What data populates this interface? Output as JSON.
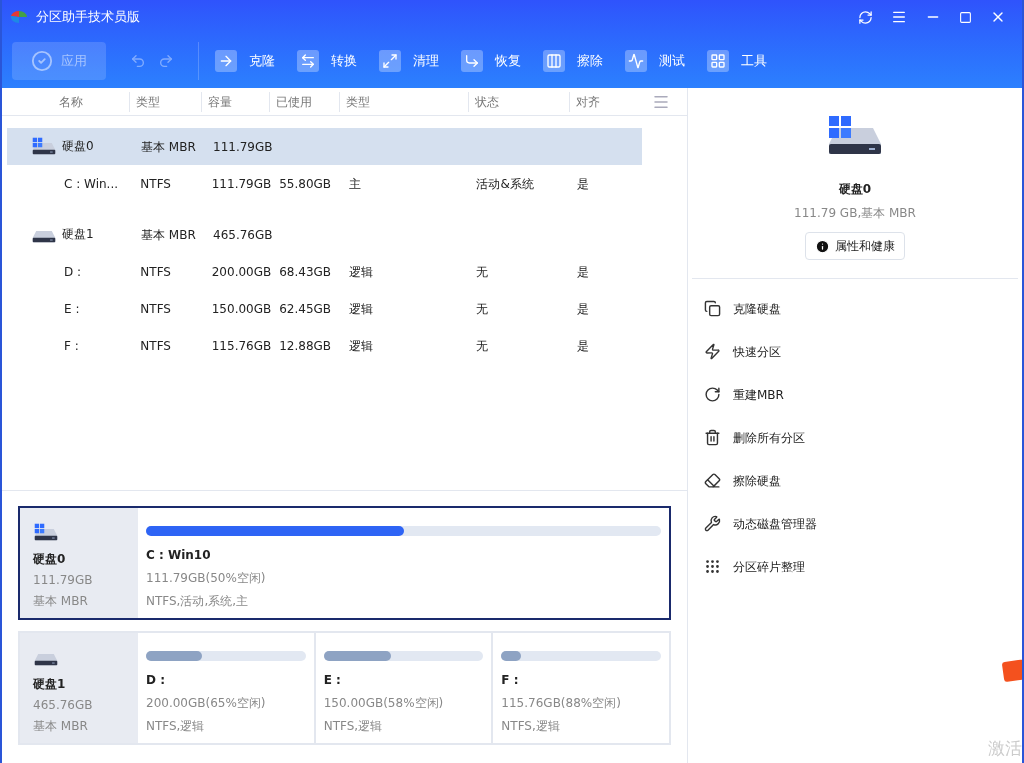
{
  "window": {
    "title": "分区助手技术员版"
  },
  "toolbar": {
    "apply": {
      "label": "应用",
      "disabled": true
    },
    "items": [
      {
        "kind": "clone",
        "label": "克隆"
      },
      {
        "kind": "convert",
        "label": "转换"
      },
      {
        "kind": "clean",
        "label": "清理"
      },
      {
        "kind": "recover",
        "label": "恢复"
      },
      {
        "kind": "wipe",
        "label": "擦除"
      },
      {
        "kind": "test",
        "label": "测试"
      },
      {
        "kind": "tools",
        "label": "工具"
      }
    ]
  },
  "table": {
    "columns": [
      "名称",
      "类型",
      "容量",
      "已使用",
      "类型",
      "状态",
      "对齐"
    ],
    "rows": [
      {
        "kind": "disk",
        "os": true,
        "selected": true,
        "cells": [
          "硬盘0",
          "基本 MBR",
          "111.79GB"
        ]
      },
      {
        "kind": "partition",
        "selected": false,
        "cells": [
          "C : Win...",
          "NTFS",
          "111.79GB",
          "55.80GB",
          "主",
          "活动&系统",
          "是"
        ]
      },
      {
        "kind": "disk",
        "os": false,
        "selected": false,
        "cells": [
          "硬盘1",
          "基本 MBR",
          "465.76GB"
        ]
      },
      {
        "kind": "partition",
        "selected": false,
        "cells": [
          "D :",
          "NTFS",
          "200.00GB",
          "68.43GB",
          "逻辑",
          "无",
          "是"
        ]
      },
      {
        "kind": "partition",
        "selected": false,
        "cells": [
          "E :",
          "NTFS",
          "150.00GB",
          "62.45GB",
          "逻辑",
          "无",
          "是"
        ]
      },
      {
        "kind": "partition",
        "selected": false,
        "cells": [
          "F :",
          "NTFS",
          "115.76GB",
          "12.88GB",
          "逻辑",
          "无",
          "是"
        ]
      }
    ]
  },
  "disk_map": [
    {
      "name": "硬盘0",
      "size": "111.79GB",
      "type": "基本 MBR",
      "os": true,
      "selected": true,
      "partitions": [
        {
          "name": "C : Win10",
          "detail": "111.79GB(50%空闲)",
          "attributes": "NTFS,活动,系统,主",
          "level": 0.5,
          "primary": true
        }
      ]
    },
    {
      "name": "硬盘1",
      "size": "465.76GB",
      "type": "基本 MBR",
      "os": false,
      "selected": false,
      "partitions": [
        {
          "name": "D :",
          "detail": "200.00GB(65%空闲)",
          "attributes": "NTFS,逻辑",
          "level": 0.35,
          "primary": false
        },
        {
          "name": "E :",
          "detail": "150.00GB(58%空闲)",
          "attributes": "NTFS,逻辑",
          "level": 0.42,
          "primary": false
        },
        {
          "name": "F :",
          "detail": "115.76GB(88%空闲)",
          "attributes": "NTFS,逻辑",
          "level": 0.12,
          "primary": false
        }
      ]
    }
  ],
  "details": {
    "title": "硬盘0",
    "subtitle": "111.79 GB,基本 MBR",
    "button": "属性和健康",
    "actions": [
      {
        "kind": "clone",
        "label": "克隆硬盘"
      },
      {
        "kind": "quick",
        "label": "快速分区"
      },
      {
        "kind": "rebuild",
        "label": "重建MBR"
      },
      {
        "kind": "delete",
        "label": "删除所有分区"
      },
      {
        "kind": "erase",
        "label": "擦除硬盘"
      },
      {
        "kind": "wrench",
        "label": "动态磁盘管理器"
      },
      {
        "kind": "defrag",
        "label": "分区碎片整理"
      }
    ]
  },
  "activation_notice": "激活"
}
